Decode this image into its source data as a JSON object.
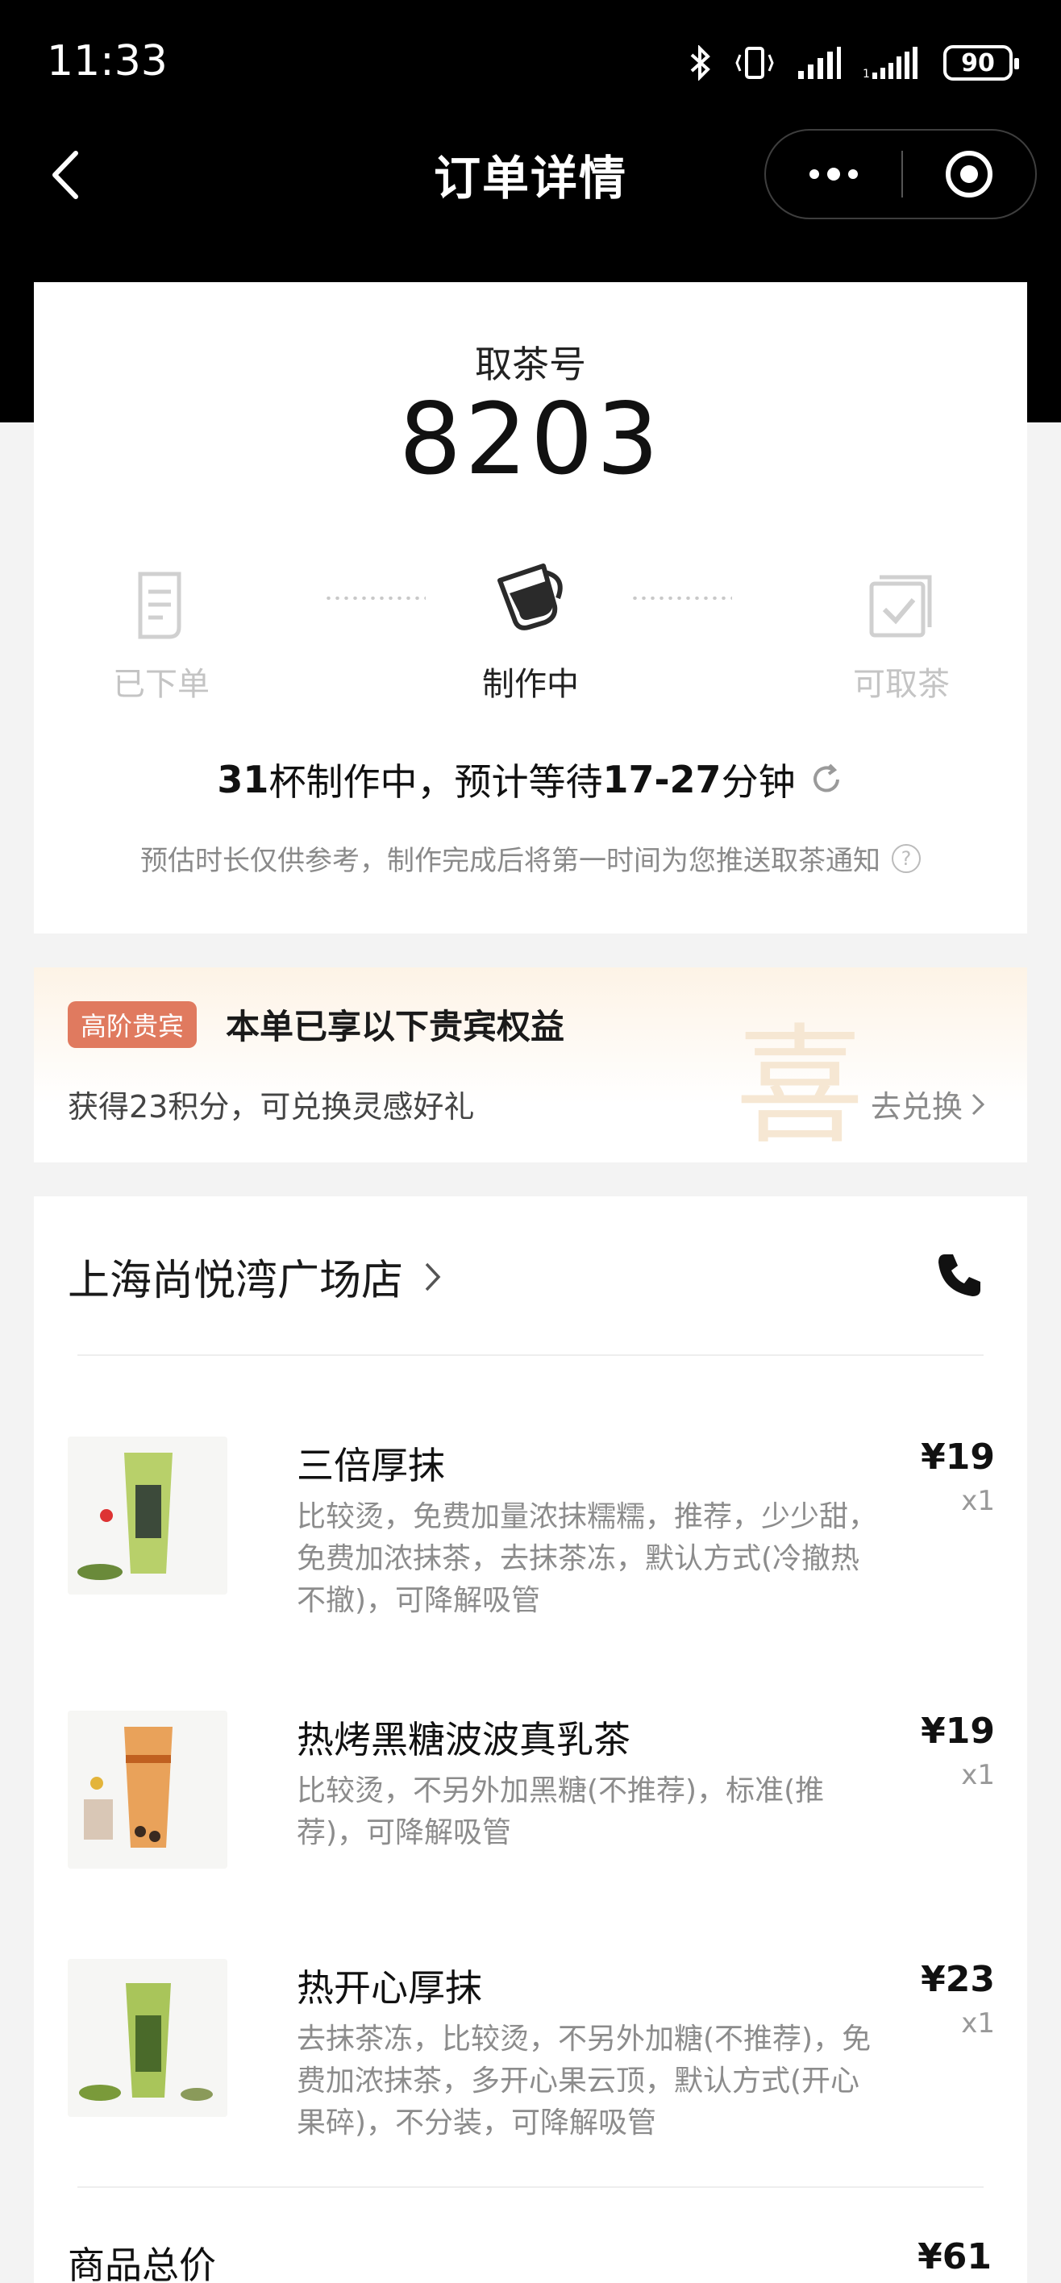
{
  "status_bar": {
    "time": "11:33",
    "battery": "90"
  },
  "nav": {
    "title": "订单详情"
  },
  "pickup": {
    "label": "取茶号",
    "number": "8203",
    "steps": [
      {
        "label": "已下单",
        "state": "done"
      },
      {
        "label": "制作中",
        "state": "active"
      },
      {
        "label": "可取茶",
        "state": "pending"
      }
    ],
    "wait": {
      "cups": "31",
      "cups_suffix": "杯制作中，预计等待",
      "range": "17-27",
      "unit": "分钟"
    },
    "note": "预估时长仅供参考，制作完成后将第一时间为您推送取茶通知"
  },
  "vip": {
    "badge": "高阶贵宾",
    "title": "本单已享以下贵宾权益",
    "subtitle": "获得23积分，可兑换灵感好礼",
    "link": "去兑换",
    "watermark": "喜"
  },
  "order": {
    "store": "上海尚悦湾广场店",
    "items": [
      {
        "name": "三倍厚抹",
        "options": "比较烫，免费加量浓抹糯糯，推荐，少少甜，免费加浓抹茶，去抹茶冻，默认方式(冷撤热不撤)，可降解吸管",
        "price": "¥19",
        "qty": "x1"
      },
      {
        "name": "热烤黑糖波波真乳茶",
        "options": "比较烫，不另外加黑糖(不推荐)，标准(推荐)，可降解吸管",
        "price": "¥19",
        "qty": "x1"
      },
      {
        "name": "热开心厚抹",
        "options": "去抹茶冻，比较烫，不另外加糖(不推荐)，免费加浓抹茶，多开心果云顶，默认方式(开心果碎)，不分装，可降解吸管",
        "price": "¥23",
        "qty": "x1"
      }
    ],
    "total_label": "商品总价",
    "total": "¥61"
  },
  "colors": {
    "accent_badge": "#e07a5f",
    "muted": "#8c8c8c",
    "header_bg": "#000000"
  }
}
